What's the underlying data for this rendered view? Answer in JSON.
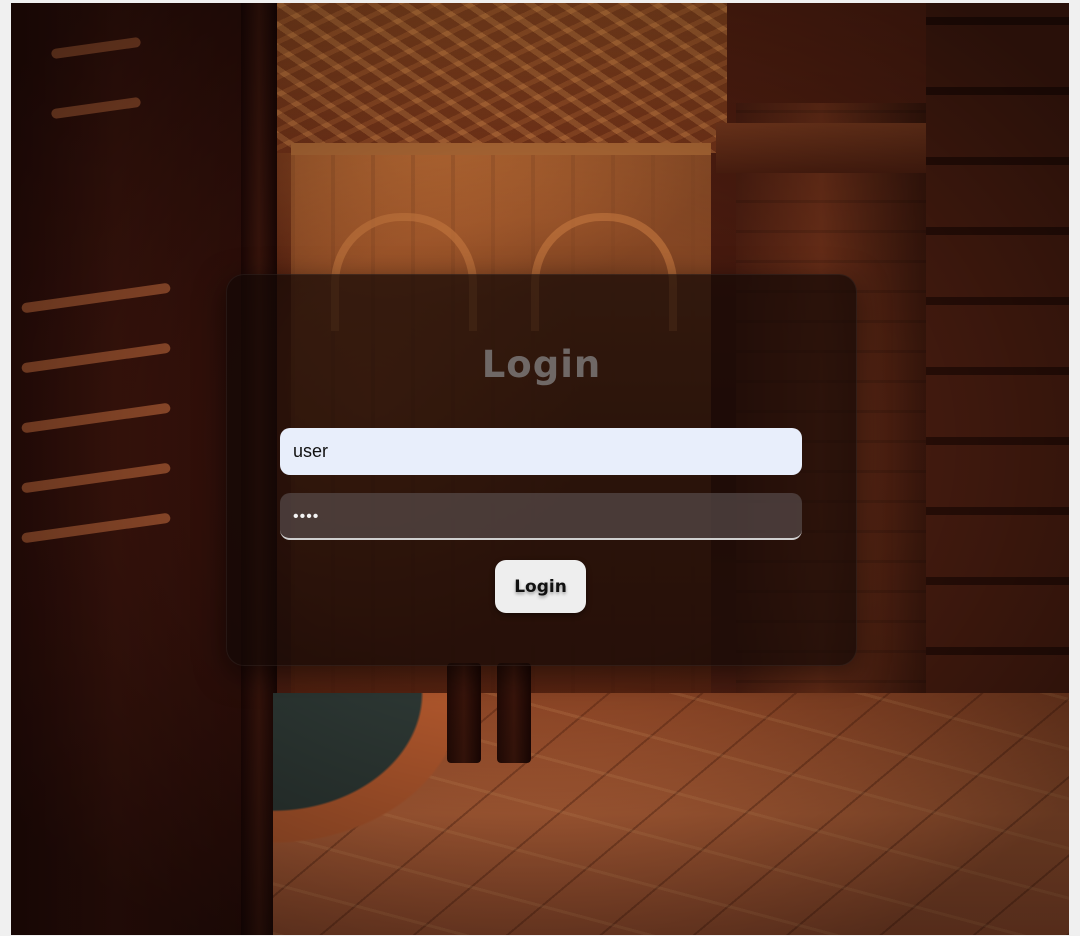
{
  "login_card": {
    "title": "Login",
    "username": {
      "value": "user"
    },
    "password": {
      "value": "••••"
    },
    "submit_label": "Login"
  },
  "colors": {
    "card_background": "#140806",
    "title_text": "#6f6866",
    "username_field_bg": "#e8eefb",
    "password_field_bg": "#5a5050",
    "button_bg": "#eeeeee",
    "page_background": "#f0f0f0"
  }
}
